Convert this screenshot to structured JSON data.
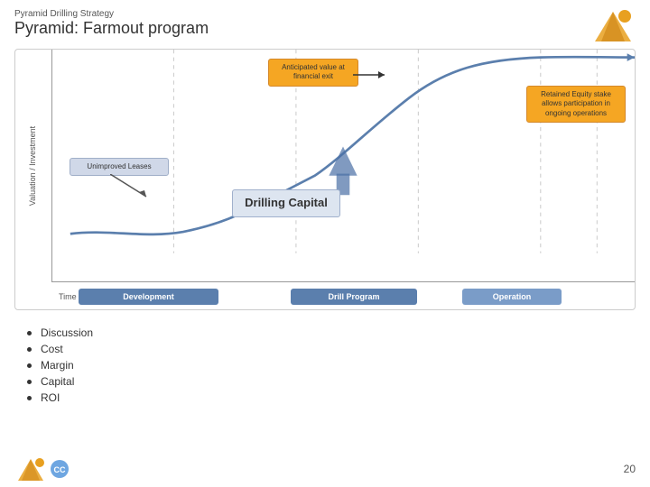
{
  "header": {
    "subtitle": "Pyramid Drilling Strategy",
    "title": "Pyramid: Farmout program"
  },
  "chart": {
    "yaxis_label": "Valuation / Investment",
    "annotation_anticipated": "Anticipated value at\nfinancial exit",
    "annotation_retained": "Retained Equity stake\nallows participation in\nongoing operations",
    "annotation_unimproved": "Unimproved Leases",
    "annotation_drilling": "Drilling Capital",
    "time_label": "Time",
    "phase_development": "Development",
    "phase_drill": "Drill Program",
    "phase_operation": "Operation"
  },
  "bullets": [
    {
      "text": "Discussion"
    },
    {
      "text": "Cost"
    },
    {
      "text": "Margin"
    },
    {
      "text": "Capital"
    },
    {
      "text": "ROI"
    }
  ],
  "footer": {
    "page_number": "20"
  }
}
